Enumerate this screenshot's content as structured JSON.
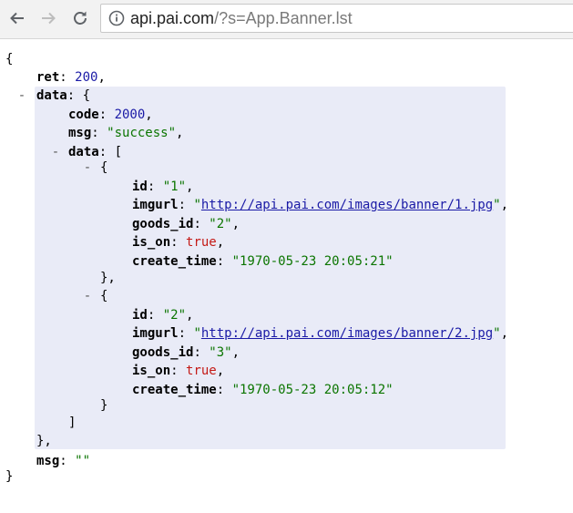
{
  "browser": {
    "url_host": "api.pai.com",
    "url_path": "/?s=App.Banner.lst"
  },
  "json": {
    "open_brace": "{",
    "close_brace": "}",
    "ret_key": "ret",
    "ret_value": "200",
    "data_key": "data",
    "code_key": "code",
    "code_value": "2000",
    "msg_key": "msg",
    "msg_value": "\"success\"",
    "inner_data_key": "data",
    "items": [
      {
        "id": "\"1\"",
        "imgurl": "http://api.pai.com/images/banner/1.jpg",
        "goods_id": "\"2\"",
        "is_on": "true",
        "create_time": "\"1970-05-23 20:05:21\""
      },
      {
        "id": "\"2\"",
        "imgurl": "http://api.pai.com/images/banner/2.jpg",
        "goods_id": "\"3\"",
        "is_on": "true",
        "create_time": "\"1970-05-23 20:05:12\""
      }
    ],
    "keys": {
      "id": "id",
      "imgurl": "imgurl",
      "goods_id": "goods_id",
      "is_on": "is_on",
      "create_time": "create_time"
    },
    "outer_msg_key": "msg",
    "outer_msg_value": "\"\"",
    "toggle_symbol": "-"
  }
}
